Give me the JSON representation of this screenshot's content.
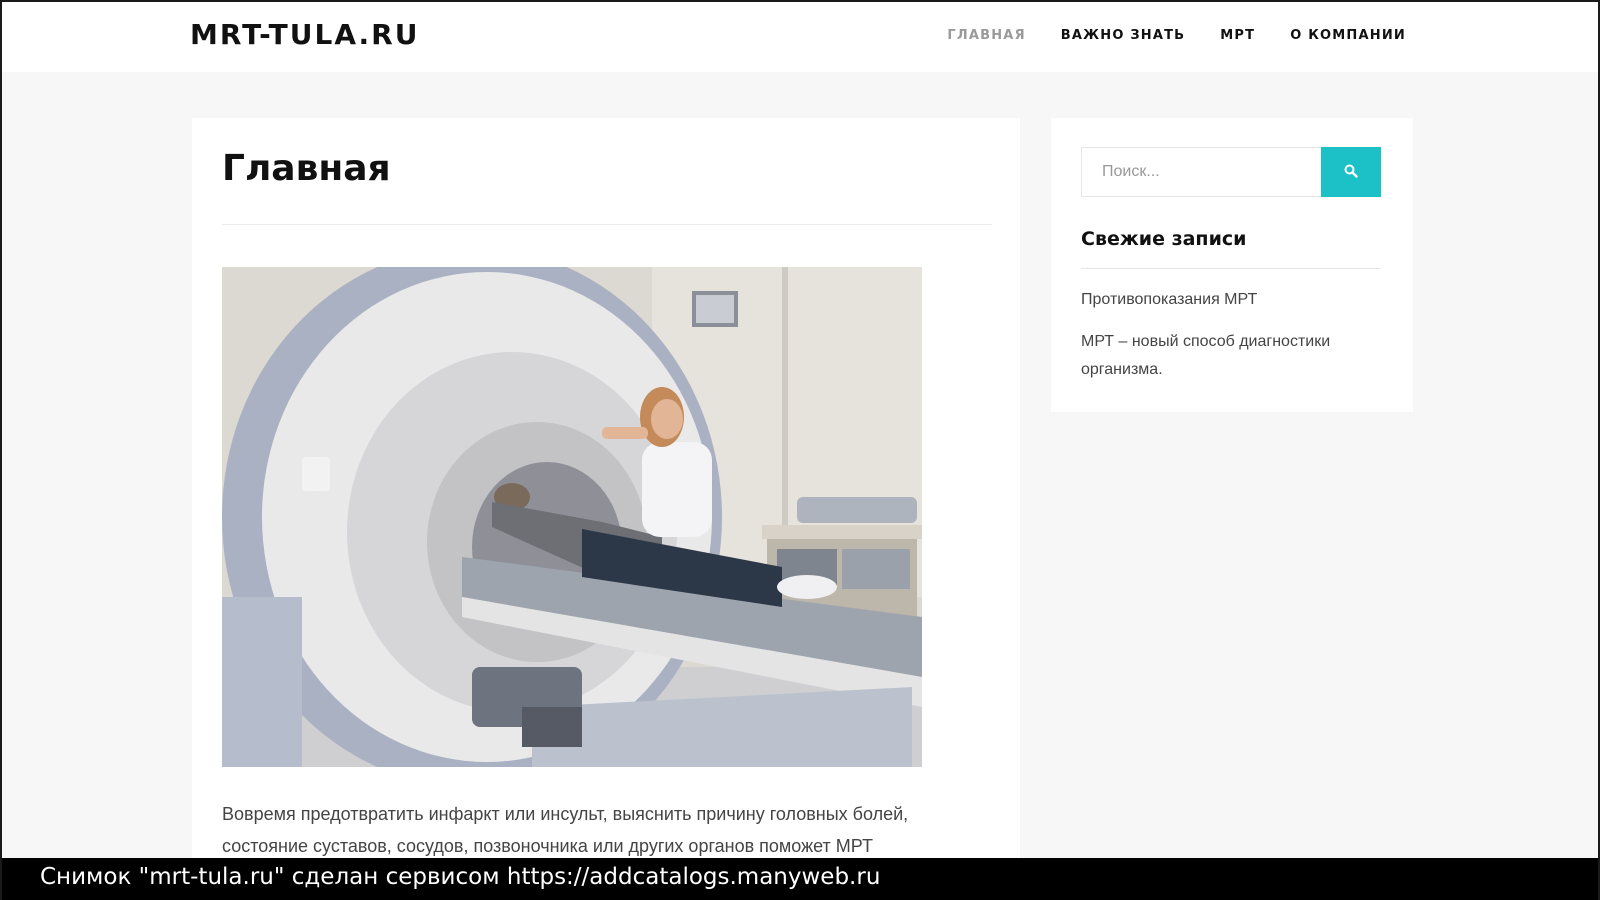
{
  "site": {
    "logo": "MRT-TULA.RU"
  },
  "nav": {
    "items": [
      {
        "label": "ГЛАВНАЯ",
        "active": true
      },
      {
        "label": "ВАЖНО ЗНАТЬ",
        "active": false
      },
      {
        "label": "МРТ",
        "active": false
      },
      {
        "label": "О КОМПАНИИ",
        "active": false
      }
    ]
  },
  "page": {
    "title": "Главная",
    "intro": "Вовремя предотвратить инфаркт или инсульт, выяснить причину головных болей, состояние суставов, сосудов, позвоночника или других органов поможет МРТ"
  },
  "sidebar": {
    "search": {
      "placeholder": "Поиск...",
      "value": "",
      "button_icon": "search-icon"
    },
    "recent_title": "Свежие записи",
    "recent_posts": [
      "Противопоказания МРТ",
      "МРТ – новый способ диагностики организма."
    ]
  },
  "footer": {
    "caption": "Снимок \"mrt-tula.ru\" сделан сервисом https://addcatalogs.manyweb.ru"
  },
  "colors": {
    "accent": "#1bc1c7",
    "nav_active": "#9a9a9a",
    "background": "#f7f7f7"
  }
}
